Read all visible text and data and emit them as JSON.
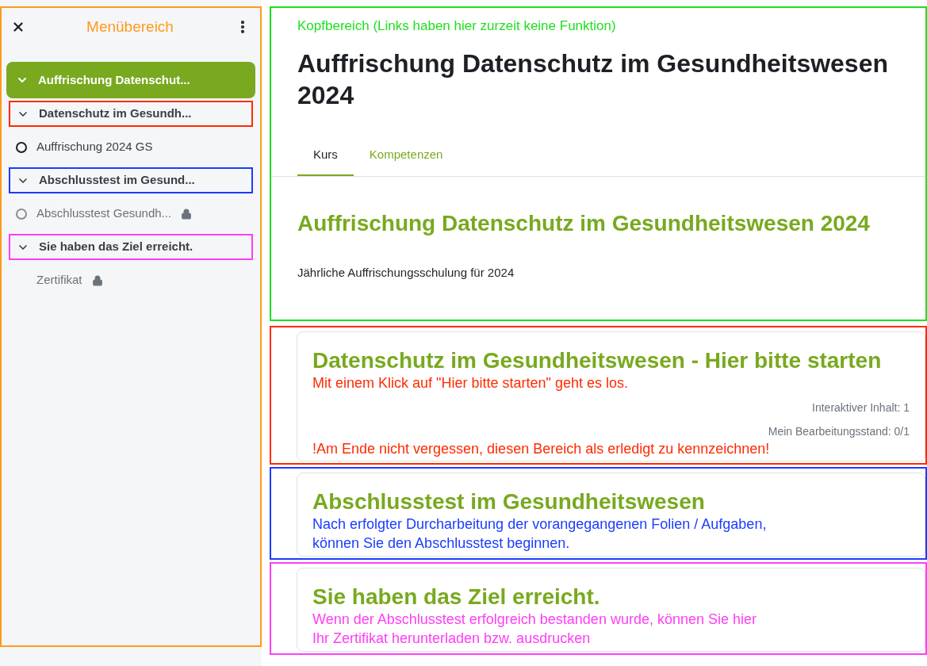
{
  "sidebar": {
    "title": "Menübereich",
    "color": "#ff9a1a",
    "course": {
      "label": "Auffrischung Datenschut...",
      "selected": true,
      "expanded": true
    },
    "sections": [
      {
        "label": "Datenschutz im Gesundh...",
        "expanded": true,
        "color": "#ff2a00",
        "children": [
          {
            "kind": "activity",
            "label": "Auffrischung 2024 GS",
            "disabled": false,
            "locked": false
          }
        ]
      },
      {
        "label": "Abschlusstest im Gesund...",
        "expanded": true,
        "color": "#1a3cff",
        "children": [
          {
            "kind": "activity",
            "label": "Abschlusstest Gesundh...",
            "disabled": true,
            "locked": true
          }
        ]
      },
      {
        "label": "Sie haben das Ziel erreicht.",
        "expanded": true,
        "color": "#ff3df5",
        "children": [
          {
            "kind": "resource",
            "label": "Zertifikat",
            "disabled": true,
            "locked": true
          }
        ]
      }
    ]
  },
  "header": {
    "color": "#1ee01e",
    "note": "Kopfbereich (Links haben hier zurzeit keine Funktion)",
    "title": "Auffrischung Datenschutz im Gesundheitswesen 2024",
    "tabs": [
      {
        "label": "Kurs",
        "selected": true
      },
      {
        "label": "Kompetenzen",
        "selected": false
      }
    ],
    "course_heading": "Auffrischung Datenschutz im Gesundheitswesen 2024",
    "summary": "Jährliche Auffrischungsschulung für 2024"
  },
  "sections": [
    {
      "title": "Datenschutz im Gesundheitswesen - Hier bitte starten",
      "color": "#ff2a00",
      "notes": [
        "Mit einem Klick auf \"Hier bitte starten\" geht es los."
      ],
      "info": [
        "Interaktiver Inhalt: 1",
        "Mein Bearbeitungsstand: 0/1"
      ],
      "footer_note": "!Am Ende nicht vergessen, diesen Bereich als erledigt zu kennzeichnen!"
    },
    {
      "title": "Abschlusstest im Gesundheitswesen",
      "color": "#1a3cff",
      "notes": [
        "Nach erfolgter Durcharbeitung der vorangegangenen Folien / Aufgaben,",
        "können Sie den Abschlusstest beginnen."
      ]
    },
    {
      "title": "Sie haben das Ziel erreicht.",
      "color": "#ff3df5",
      "notes": [
        "Wenn der Abschlusstest erfolgreich bestanden wurde, können Sie hier",
        "Ihr Zertifikat herunterladen bzw. ausdrucken"
      ]
    }
  ]
}
